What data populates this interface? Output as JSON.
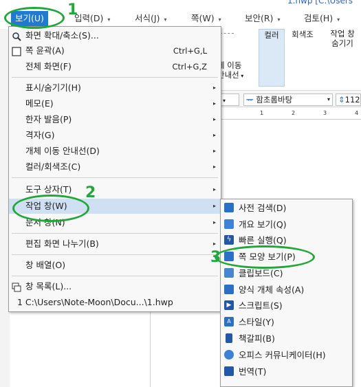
{
  "window": {
    "title_path": "1.hwp [C:\\Users"
  },
  "menubar": {
    "tabs": [
      {
        "label": "보기(U)",
        "active": true
      },
      {
        "label": "입력(D)"
      },
      {
        "label": "서식(J)"
      },
      {
        "label": "쪽(W)"
      },
      {
        "label": "보안(R)"
      },
      {
        "label": "검토(H)"
      }
    ]
  },
  "ribbon": {
    "buttons": [
      {
        "label": "컬러"
      },
      {
        "label": "회색조"
      },
      {
        "label": "작업 창"
      },
      {
        "label": "숨기기"
      }
    ],
    "partial_left_line1": "체 이동",
    "partial_left_line2": "안내선"
  },
  "format_bar": {
    "font_name": "함초롬바탕",
    "font_size": "112"
  },
  "ruler": {
    "labels": [
      "1",
      "2",
      "3",
      "4"
    ]
  },
  "main_menu": {
    "items": [
      {
        "label": "화면 확대/축소(S)...",
        "shortcut": "",
        "submenu": false,
        "icon": "magnifier-icon"
      },
      {
        "label": "쪽 윤곽(A)",
        "shortcut": "Ctrl+G,L",
        "submenu": false,
        "icon": "page-outline-icon"
      },
      {
        "label": "전체 화면(F)",
        "shortcut": "Ctrl+G,Z",
        "submenu": false,
        "icon": ""
      },
      {
        "label": "표시/숨기기(H)",
        "shortcut": "",
        "submenu": true
      },
      {
        "label": "메모(E)",
        "shortcut": "",
        "submenu": true
      },
      {
        "label": "한자 발음(P)",
        "shortcut": "",
        "submenu": true
      },
      {
        "label": "격자(G)",
        "shortcut": "",
        "submenu": true
      },
      {
        "label": "개체 이동 안내선(D)",
        "shortcut": "",
        "submenu": true
      },
      {
        "label": "컬러/회색조(C)",
        "shortcut": "",
        "submenu": true
      },
      {
        "label": "도구 상자(T)",
        "shortcut": "",
        "submenu": true
      },
      {
        "label": "작업 창(W)",
        "shortcut": "",
        "submenu": true,
        "highlighted": true
      },
      {
        "label": "문서 창(N)",
        "shortcut": "",
        "submenu": true
      },
      {
        "label": "편집 화면 나누기(B)",
        "shortcut": "",
        "submenu": true
      },
      {
        "label": "창 배열(O)",
        "shortcut": "",
        "submenu": false
      },
      {
        "label": "창 목록(L)...",
        "shortcut": "",
        "submenu": false,
        "icon": "window-list-icon"
      },
      {
        "label": "1 C:\\Users\\Note-Moon\\Docu...\\1.hwp",
        "shortcut": "",
        "submenu": false
      }
    ]
  },
  "sub_menu": {
    "items": [
      {
        "label": "사전 검색(D)",
        "icon": "dictionary-icon",
        "color": "#2b6fc7"
      },
      {
        "label": "개요 보기(Q)",
        "icon": "outline-icon",
        "color": "#2b6fc7"
      },
      {
        "label": "빠른 실행(Q)",
        "icon": "lightning-icon",
        "color": "#2b6fc7"
      },
      {
        "label": "쪽 모양 보기(P)",
        "icon": "page-shape-icon",
        "color": "#2b6fc7"
      },
      {
        "label": "클립보드(C)",
        "icon": "clipboard-icon",
        "color": "#2b6fc7"
      },
      {
        "label": "양식 개체 속성(A)",
        "icon": "form-object-icon",
        "color": "#2b6fc7"
      },
      {
        "label": "스크립트(S)",
        "icon": "script-icon",
        "color": "#2b6fc7"
      },
      {
        "label": "스타일(Y)",
        "icon": "style-icon",
        "color": "#2b6fc7"
      },
      {
        "label": "책갈피(B)",
        "icon": "bookmark-icon",
        "color": "#2b6fc7"
      },
      {
        "label": "오피스 커뮤니케이터(H)",
        "icon": "chat-icon",
        "color": "#2b6fc7"
      },
      {
        "label": "번역(T)",
        "icon": "translate-icon",
        "color": "#2b6fc7"
      }
    ]
  },
  "annotations": {
    "num1": "1",
    "num2": "2",
    "num3": "3",
    "color": "#22a83a"
  },
  "colors": {
    "accent": "#1f7bd1",
    "highlight": "#cfe0f3"
  }
}
